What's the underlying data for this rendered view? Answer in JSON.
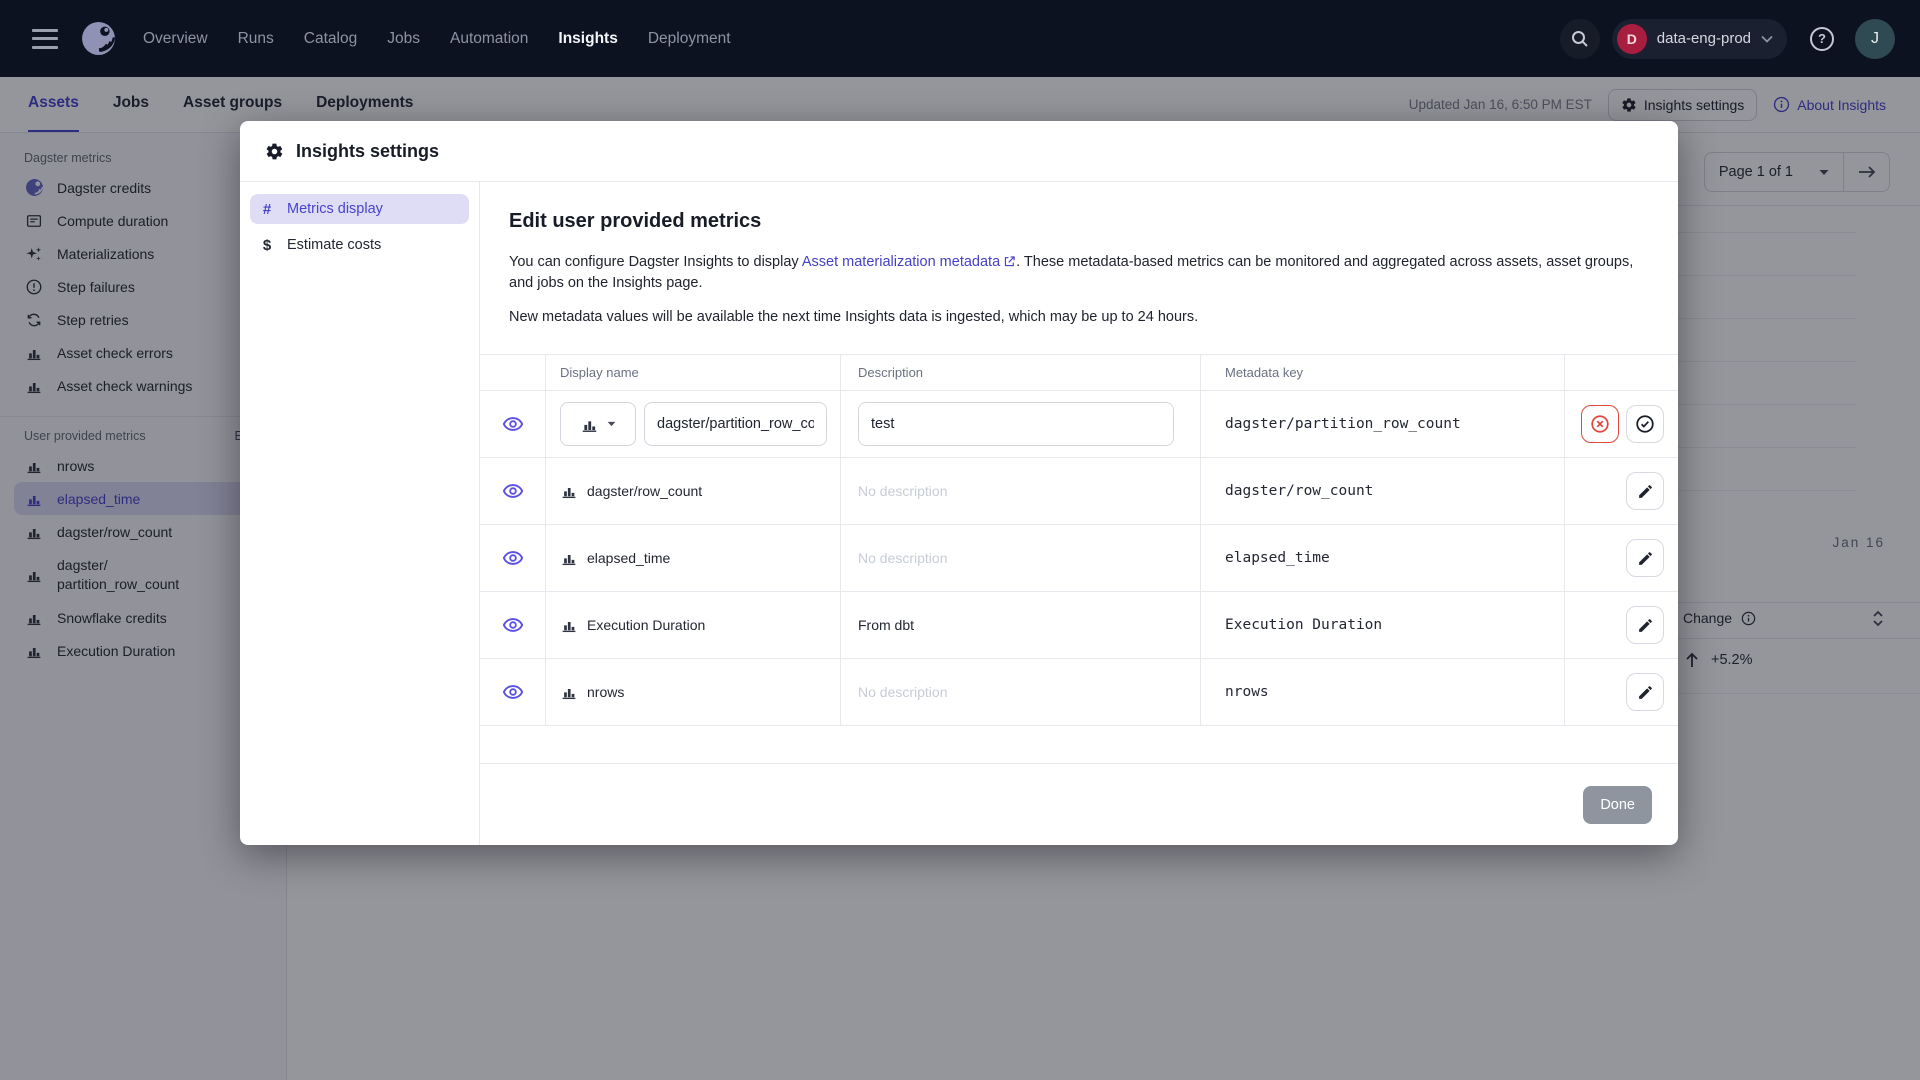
{
  "topnav": {
    "nav_items": [
      {
        "label": "Overview"
      },
      {
        "label": "Runs"
      },
      {
        "label": "Catalog"
      },
      {
        "label": "Jobs"
      },
      {
        "label": "Automation"
      },
      {
        "label": "Insights"
      },
      {
        "label": "Deployment"
      }
    ],
    "workspace": {
      "initial": "D",
      "name": "data-eng-prod"
    },
    "avatar_initial": "J"
  },
  "subnav": {
    "tabs": [
      {
        "label": "Assets"
      },
      {
        "label": "Jobs"
      },
      {
        "label": "Asset groups"
      },
      {
        "label": "Deployments"
      }
    ],
    "updated": "Updated Jan 16, 6:50 PM EST",
    "settings_button": "Insights settings",
    "about_link": "About Insights"
  },
  "sidebar": {
    "sections": [
      {
        "title": "Dagster metrics",
        "items": [
          {
            "label": "Dagster credits"
          },
          {
            "label": "Compute duration"
          },
          {
            "label": "Materializations"
          },
          {
            "label": "Step failures"
          },
          {
            "label": "Step retries"
          },
          {
            "label": "Asset check errors"
          },
          {
            "label": "Asset check warnings"
          }
        ]
      },
      {
        "title": "User provided metrics",
        "edit_label": "Edit",
        "items": [
          {
            "label": "nrows"
          },
          {
            "label": "elapsed_time"
          },
          {
            "label": "dagster/row_count"
          },
          {
            "label": "dagster/ partition_row_count"
          },
          {
            "label": "Snowflake credits"
          },
          {
            "label": "Execution Duration"
          }
        ]
      }
    ]
  },
  "modal": {
    "title": "Insights settings",
    "nav": [
      {
        "glyph": "#",
        "label": "Metrics display"
      },
      {
        "glyph": "$",
        "label": "Estimate costs"
      }
    ],
    "heading": "Edit user provided metrics",
    "intro_before": "You can configure Dagster Insights to display ",
    "intro_link": "Asset materialization metadata",
    "intro_after": ". These metadata-based metrics can be monitored and aggregated across assets, asset groups, and jobs on the Insights page.",
    "note": "New metadata values will be available the next time Insights data is ingested, which may be up to 24 hours.",
    "table": {
      "col_display": "Display name",
      "col_description": "Description",
      "col_metadata": "Metadata key",
      "edit_row": {
        "name_value": "dagster/partition_row_count",
        "description_value": "test",
        "metadata_key": "dagster/partition_row_count"
      },
      "rows": [
        {
          "display": "dagster/row_count",
          "description": "No description",
          "metadata": "dagster/row_count"
        },
        {
          "display": "elapsed_time",
          "description": "No description",
          "metadata": "elapsed_time"
        },
        {
          "display": "Execution Duration",
          "description": "From dbt",
          "metadata": "Execution Duration"
        },
        {
          "display": "nrows",
          "description": "No description",
          "metadata": "nrows"
        }
      ]
    },
    "done_label": "Done"
  },
  "background": {
    "pagination_label": "Page 1 of 1",
    "axis_label": "Jan 16",
    "change_header": "Change",
    "change_value": "+5.2%"
  },
  "colors": {
    "accent": "#4843CE",
    "link": "#4541C8",
    "danger": "#E0483F",
    "topnav_bg": "#0D1220"
  }
}
